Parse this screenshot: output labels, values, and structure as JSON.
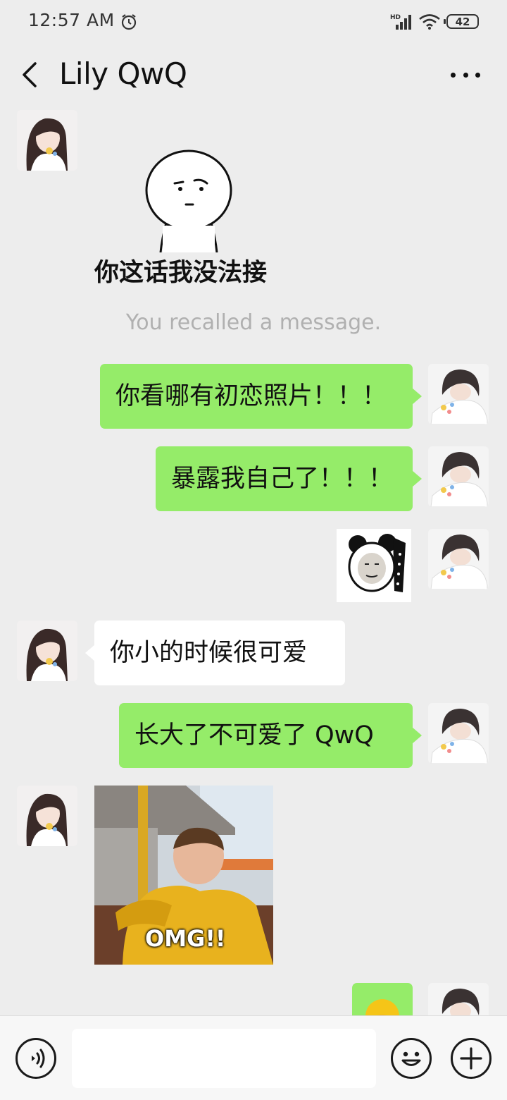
{
  "status_bar": {
    "time": "12:57  AM",
    "network": "HD",
    "battery": "42",
    "icons": [
      "alarm-icon",
      "signal-icon",
      "wifi-icon",
      "battery-icon"
    ]
  },
  "header": {
    "title": "Lily QwQ",
    "icons": [
      "back-arrow-icon",
      "more-icon"
    ]
  },
  "messages": {
    "m1_sticker_caption": "你这话我没法接",
    "recall_notice": "You recalled a message.",
    "m2_text": "你看哪有初恋照片！！！",
    "m3_text": "暴露我自己了！！！",
    "m4_sticker": "panda-face-sticker",
    "m5_text": "你小的时候很可爱",
    "m6_text": "长大了不可爱了 QwQ",
    "m7_image_caption": "OMG!!",
    "m8_sticker": "face-palm-emoji"
  },
  "input_bar": {
    "message_value": "",
    "icons": [
      "voice-icon",
      "emoji-icon",
      "plus-icon"
    ]
  },
  "colors": {
    "background": "#ededed",
    "outgoing_bubble": "#95ec69",
    "incoming_bubble": "#ffffff",
    "system_text": "#b0b0b0"
  }
}
